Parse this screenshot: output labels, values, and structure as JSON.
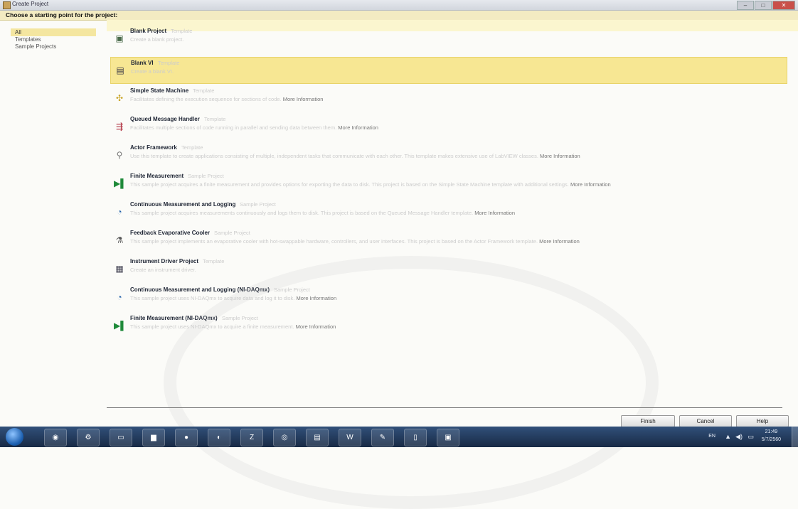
{
  "window": {
    "title": "Create Project"
  },
  "header": {
    "prompt": "Choose a starting point for the project:"
  },
  "categories": [
    "All",
    "Templates",
    "Sample Projects"
  ],
  "items": [
    {
      "name": "Blank Project",
      "tag": "Template",
      "desc": "Create a blank project.",
      "more": "",
      "icon": "blank-project-icon",
      "glyph": "▣",
      "color": "#4a6a4a",
      "selected": false
    },
    {
      "name": "Blank VI",
      "tag": "Template",
      "desc": "Create a blank VI.",
      "more": "",
      "icon": "blank-vi-icon",
      "glyph": "▤",
      "color": "#334",
      "selected": true
    },
    {
      "name": "Simple State Machine",
      "tag": "Template",
      "desc": "Facilitates defining the execution sequence for sections of code.",
      "more": "More Information",
      "icon": "state-machine-icon",
      "glyph": "✣",
      "color": "#c9a526",
      "selected": false
    },
    {
      "name": "Queued Message Handler",
      "tag": "Template",
      "desc": "Facilitates multiple sections of code running in parallel and sending data between them.",
      "more": "More Information",
      "icon": "message-handler-icon",
      "glyph": "⇶",
      "color": "#a23",
      "selected": false
    },
    {
      "name": "Actor Framework",
      "tag": "Template",
      "desc": "Use this template to create applications consisting of multiple, independent tasks that communicate with each other. This template makes extensive use of LabVIEW classes.",
      "more": "More Information",
      "icon": "actor-framework-icon",
      "glyph": "⚲",
      "color": "#777",
      "selected": false
    },
    {
      "name": "Finite Measurement",
      "tag": "Sample Project",
      "desc": "This sample project acquires a finite measurement and provides options for exporting the data to disk. This project is based on the Simple State Machine template with additional settings.",
      "more": "More Information",
      "icon": "finite-measurement-icon",
      "glyph": "▶▌",
      "color": "#1f8a3a",
      "selected": false
    },
    {
      "name": "Continuous Measurement and Logging",
      "tag": "Sample Project",
      "desc": "This sample project acquires measurements continuously and logs them to disk. This project is based on the Queued Message Handler template.",
      "more": "More Information",
      "icon": "continuous-measurement-icon",
      "glyph": "◔",
      "color": "#1f5fa8",
      "selected": false
    },
    {
      "name": "Feedback Evaporative Cooler",
      "tag": "Sample Project",
      "desc": "This sample project implements an evaporative cooler with hot-swappable hardware, controllers, and user interfaces. This project is based on the Actor Framework template.",
      "more": "More Information",
      "icon": "evaporative-cooler-icon",
      "glyph": "⚗",
      "color": "#555",
      "selected": false
    },
    {
      "name": "Instrument Driver Project",
      "tag": "Template",
      "desc": "Create an instrument driver.",
      "more": "",
      "icon": "instrument-driver-icon",
      "glyph": "▦",
      "color": "#445",
      "selected": false
    },
    {
      "name": "Continuous Measurement and Logging (NI-DAQmx)",
      "tag": "Sample Project",
      "desc": "This sample project uses NI-DAQmx to acquire data and log it to disk.",
      "more": "More Information",
      "icon": "daqmx-continuous-icon",
      "glyph": "◔",
      "color": "#1f5fa8",
      "selected": false
    },
    {
      "name": "Finite Measurement (NI-DAQmx)",
      "tag": "Sample Project",
      "desc": "This sample project uses NI-DAQmx to acquire a finite measurement.",
      "more": "More Information",
      "icon": "daqmx-finite-icon",
      "glyph": "▶▌",
      "color": "#1f8a3a",
      "selected": false
    }
  ],
  "buttons": {
    "finish": "Finish",
    "cancel": "Cancel",
    "help": "Help"
  },
  "taskbar": {
    "apps": [
      {
        "icon": "steam-icon",
        "glyph": "◉"
      },
      {
        "icon": "tool-icon",
        "glyph": "⚙"
      },
      {
        "icon": "window-icon",
        "glyph": "▭"
      },
      {
        "icon": "folder-icon",
        "glyph": "▆"
      },
      {
        "icon": "line-chat-icon",
        "glyph": "●"
      },
      {
        "icon": "media-icon",
        "glyph": "◐"
      },
      {
        "icon": "filezilla-icon",
        "glyph": "Z"
      },
      {
        "icon": "chrome-icon",
        "glyph": "◎"
      },
      {
        "icon": "notepad-icon",
        "glyph": "▤"
      },
      {
        "icon": "word-icon",
        "glyph": "W"
      },
      {
        "icon": "paint-icon",
        "glyph": "✎"
      },
      {
        "icon": "document-icon",
        "glyph": "▯"
      },
      {
        "icon": "labview-icon",
        "glyph": "▣"
      }
    ],
    "lang": "EN",
    "time": "21:49",
    "date": "5/7/2560"
  }
}
